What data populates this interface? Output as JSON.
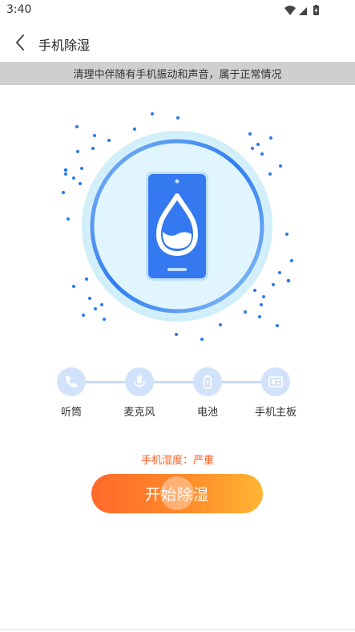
{
  "status_bar": {
    "time": "3:40",
    "icons": [
      "wifi-icon",
      "cell-signal-icon",
      "battery-charging-icon"
    ]
  },
  "app_bar": {
    "back_icon": "chevron-left-icon",
    "title": "手机除湿"
  },
  "notice": {
    "text": "清理中伴随有手机振动和声音，属于正常情况"
  },
  "hero": {
    "icon": "phone-water-drop-icon",
    "colors": {
      "ring": "#2f7df0",
      "glow": "#dff4fc",
      "phone": "#3479f0",
      "dots": "#2a7ae8"
    }
  },
  "steps": [
    {
      "icon": "phone-receiver-icon",
      "label": "听筒"
    },
    {
      "icon": "microphone-icon",
      "label": "麦克风"
    },
    {
      "icon": "battery-icon",
      "label": "电池"
    },
    {
      "icon": "motherboard-icon",
      "label": "手机主板"
    }
  ],
  "humidity": {
    "text": "手机湿度：严重",
    "color": "#ff5a1f"
  },
  "start_button": {
    "label": "开始除湿",
    "gradient": [
      "#ff6a2a",
      "#ffb534"
    ]
  }
}
